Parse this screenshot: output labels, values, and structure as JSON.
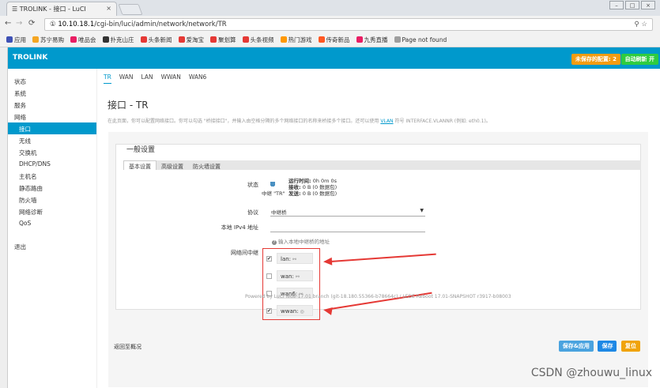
{
  "browser": {
    "tab_title": "TROLINK - 接口 - LuCI",
    "tab_close": "×",
    "url_host": "10.10.18.1",
    "url_path": "/cgi-bin/luci/admin/network/network/TR",
    "url_prefix": "①",
    "bookmarks": [
      {
        "label": "应用",
        "color": "#3f51b5"
      },
      {
        "label": "苏宁易购",
        "color": "#f5a623"
      },
      {
        "label": "唯品会",
        "color": "#e91e63"
      },
      {
        "label": "扑克山庄",
        "color": "#333333"
      },
      {
        "label": "头条新闻",
        "color": "#e53935"
      },
      {
        "label": "爱淘宝",
        "color": "#e53935"
      },
      {
        "label": "聚划算",
        "color": "#e53935"
      },
      {
        "label": "头条视频",
        "color": "#e53935"
      },
      {
        "label": "热门游戏",
        "color": "#ff9800"
      },
      {
        "label": "传奇新品",
        "color": "#ff5722"
      },
      {
        "label": "九秀直播",
        "color": "#e91e63"
      },
      {
        "label": "Page not found",
        "color": "#9e9e9e"
      }
    ]
  },
  "header": {
    "brand": "TROLINK",
    "unsaved": "未保存的配置: 2",
    "autorefresh": "自动刷新 开"
  },
  "sidebar": {
    "items": [
      {
        "label": "状态",
        "sub": false,
        "active": false
      },
      {
        "label": "系统",
        "sub": false,
        "active": false
      },
      {
        "label": "服务",
        "sub": false,
        "active": false
      },
      {
        "label": "网络",
        "sub": false,
        "active": false
      },
      {
        "label": "接口",
        "sub": true,
        "active": true
      },
      {
        "label": "无线",
        "sub": true,
        "active": false
      },
      {
        "label": "交换机",
        "sub": true,
        "active": false
      },
      {
        "label": "DHCP/DNS",
        "sub": true,
        "active": false
      },
      {
        "label": "主机名",
        "sub": true,
        "active": false
      },
      {
        "label": "静态路由",
        "sub": true,
        "active": false
      },
      {
        "label": "防火墙",
        "sub": true,
        "active": false
      },
      {
        "label": "网络诊断",
        "sub": true,
        "active": false
      },
      {
        "label": "QoS",
        "sub": true,
        "active": false
      }
    ],
    "logout": "退出"
  },
  "topnav": [
    "TR",
    "WAN",
    "LAN",
    "WWAN",
    "WAN6"
  ],
  "page": {
    "title": "接口 - TR",
    "desc_before": "在此页面，你可以配置网络接口。你可以勾选 \"桥接接口\"，并输入由空格分隔的多个网络接口的名称来桥接多个接口。还可以使用",
    "desc_link": "VLAN",
    "desc_after": "符号 INTERFACE.VLANNR (例如: eth0.1)。"
  },
  "settings": {
    "legend": "一般设置",
    "tabs": [
      "基本设置",
      "高级设置",
      "防火墙设置"
    ],
    "status_label": "状态",
    "status_name": "中继 \"TR\"",
    "uptime_label": "运行时间:",
    "uptime_value": "0h 0m 0s",
    "rx_label": "接收:",
    "rx_value": "0 B (0 数据包)",
    "tx_label": "发送:",
    "tx_value": "0 B (0 数据包)",
    "protocol_label": "协议",
    "protocol_value": "中继桥",
    "ipv4_label": "本地 IPv4 地址",
    "ipv4_hint": "输入本地中继桥的地址",
    "relay_label": "网络间中继",
    "relay_items": [
      {
        "label": "lan:",
        "checked": true
      },
      {
        "label": "wan:",
        "checked": false
      },
      {
        "label": "wan6:",
        "checked": false
      },
      {
        "label": "wwan:",
        "checked": true
      }
    ]
  },
  "footer": {
    "back": "返回至概况",
    "apply": "保存&应用",
    "save": "保存",
    "reset": "复位",
    "powered": "Powered by LuCI lede-17.01 branch (git-18.180.55366-b78664c) / LEDE Reboot 17.01-SNAPSHOT r3917-b08003"
  },
  "watermark": "CSDN @zhouwu_linux"
}
